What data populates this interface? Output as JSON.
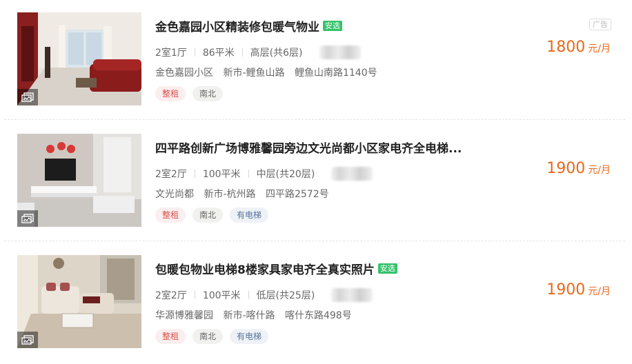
{
  "listings": [
    {
      "title": "金色嘉园小区精装修包暖气物业",
      "safe_badge": "安选",
      "ad_label": "广告",
      "layout": "2室1厅",
      "area": "86平米",
      "floor": "高层(共6层)",
      "community": "金色嘉园小区",
      "district": "新市-鲤鱼山路",
      "street": "鲤鱼山南路1140号",
      "tags": [
        "整租",
        "南北"
      ],
      "price": "1800",
      "price_unit": "元/月"
    },
    {
      "title": "四平路创新广场博雅馨园旁边文光尚都小区家电齐全电梯...",
      "layout": "2室2厅",
      "area": "100平米",
      "floor": "中层(共20层)",
      "community": "文光尚都",
      "district": "新市-杭州路",
      "street": "四平路2572号",
      "tags": [
        "整租",
        "南北",
        "有电梯"
      ],
      "price": "1900",
      "price_unit": "元/月"
    },
    {
      "title": "包暖包物业电梯8楼家具家电齐全真实照片",
      "safe_badge": "安选",
      "layout": "2室2厅",
      "area": "100平米",
      "floor": "低层(共25层)",
      "community": "华源博雅馨园",
      "district": "新市-喀什路",
      "street": "喀什东路498号",
      "tags": [
        "整租",
        "南北",
        "有电梯"
      ],
      "price": "1900",
      "price_unit": "元/月"
    }
  ],
  "colors": {
    "price": "#e8681a",
    "safe_badge": "#35c26b",
    "tag_rent": "#d9534f",
    "tag_elevator": "#55729a"
  },
  "icons": {
    "photo_badge": "image-gallery-icon"
  }
}
